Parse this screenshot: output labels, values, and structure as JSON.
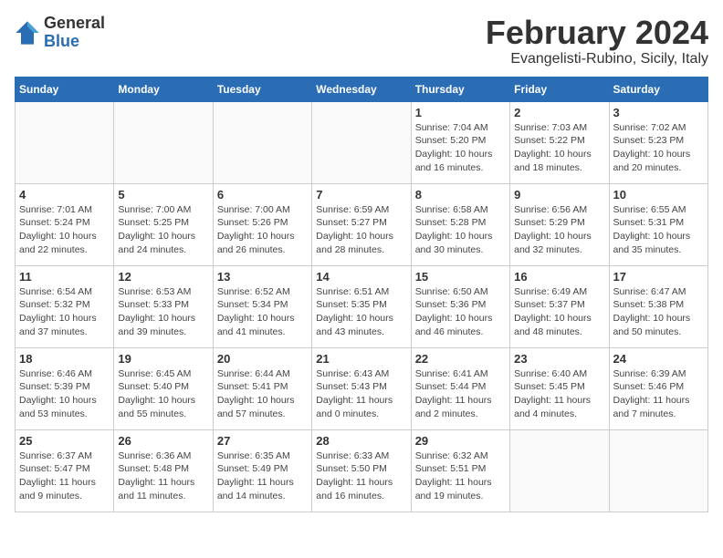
{
  "header": {
    "logo_general": "General",
    "logo_blue": "Blue",
    "title": "February 2024",
    "subtitle": "Evangelisti-Rubino, Sicily, Italy"
  },
  "weekdays": [
    "Sunday",
    "Monday",
    "Tuesday",
    "Wednesday",
    "Thursday",
    "Friday",
    "Saturday"
  ],
  "weeks": [
    [
      {
        "day": "",
        "info": ""
      },
      {
        "day": "",
        "info": ""
      },
      {
        "day": "",
        "info": ""
      },
      {
        "day": "",
        "info": ""
      },
      {
        "day": "1",
        "info": "Sunrise: 7:04 AM\nSunset: 5:20 PM\nDaylight: 10 hours\nand 16 minutes."
      },
      {
        "day": "2",
        "info": "Sunrise: 7:03 AM\nSunset: 5:22 PM\nDaylight: 10 hours\nand 18 minutes."
      },
      {
        "day": "3",
        "info": "Sunrise: 7:02 AM\nSunset: 5:23 PM\nDaylight: 10 hours\nand 20 minutes."
      }
    ],
    [
      {
        "day": "4",
        "info": "Sunrise: 7:01 AM\nSunset: 5:24 PM\nDaylight: 10 hours\nand 22 minutes."
      },
      {
        "day": "5",
        "info": "Sunrise: 7:00 AM\nSunset: 5:25 PM\nDaylight: 10 hours\nand 24 minutes."
      },
      {
        "day": "6",
        "info": "Sunrise: 7:00 AM\nSunset: 5:26 PM\nDaylight: 10 hours\nand 26 minutes."
      },
      {
        "day": "7",
        "info": "Sunrise: 6:59 AM\nSunset: 5:27 PM\nDaylight: 10 hours\nand 28 minutes."
      },
      {
        "day": "8",
        "info": "Sunrise: 6:58 AM\nSunset: 5:28 PM\nDaylight: 10 hours\nand 30 minutes."
      },
      {
        "day": "9",
        "info": "Sunrise: 6:56 AM\nSunset: 5:29 PM\nDaylight: 10 hours\nand 32 minutes."
      },
      {
        "day": "10",
        "info": "Sunrise: 6:55 AM\nSunset: 5:31 PM\nDaylight: 10 hours\nand 35 minutes."
      }
    ],
    [
      {
        "day": "11",
        "info": "Sunrise: 6:54 AM\nSunset: 5:32 PM\nDaylight: 10 hours\nand 37 minutes."
      },
      {
        "day": "12",
        "info": "Sunrise: 6:53 AM\nSunset: 5:33 PM\nDaylight: 10 hours\nand 39 minutes."
      },
      {
        "day": "13",
        "info": "Sunrise: 6:52 AM\nSunset: 5:34 PM\nDaylight: 10 hours\nand 41 minutes."
      },
      {
        "day": "14",
        "info": "Sunrise: 6:51 AM\nSunset: 5:35 PM\nDaylight: 10 hours\nand 43 minutes."
      },
      {
        "day": "15",
        "info": "Sunrise: 6:50 AM\nSunset: 5:36 PM\nDaylight: 10 hours\nand 46 minutes."
      },
      {
        "day": "16",
        "info": "Sunrise: 6:49 AM\nSunset: 5:37 PM\nDaylight: 10 hours\nand 48 minutes."
      },
      {
        "day": "17",
        "info": "Sunrise: 6:47 AM\nSunset: 5:38 PM\nDaylight: 10 hours\nand 50 minutes."
      }
    ],
    [
      {
        "day": "18",
        "info": "Sunrise: 6:46 AM\nSunset: 5:39 PM\nDaylight: 10 hours\nand 53 minutes."
      },
      {
        "day": "19",
        "info": "Sunrise: 6:45 AM\nSunset: 5:40 PM\nDaylight: 10 hours\nand 55 minutes."
      },
      {
        "day": "20",
        "info": "Sunrise: 6:44 AM\nSunset: 5:41 PM\nDaylight: 10 hours\nand 57 minutes."
      },
      {
        "day": "21",
        "info": "Sunrise: 6:43 AM\nSunset: 5:43 PM\nDaylight: 11 hours\nand 0 minutes."
      },
      {
        "day": "22",
        "info": "Sunrise: 6:41 AM\nSunset: 5:44 PM\nDaylight: 11 hours\nand 2 minutes."
      },
      {
        "day": "23",
        "info": "Sunrise: 6:40 AM\nSunset: 5:45 PM\nDaylight: 11 hours\nand 4 minutes."
      },
      {
        "day": "24",
        "info": "Sunrise: 6:39 AM\nSunset: 5:46 PM\nDaylight: 11 hours\nand 7 minutes."
      }
    ],
    [
      {
        "day": "25",
        "info": "Sunrise: 6:37 AM\nSunset: 5:47 PM\nDaylight: 11 hours\nand 9 minutes."
      },
      {
        "day": "26",
        "info": "Sunrise: 6:36 AM\nSunset: 5:48 PM\nDaylight: 11 hours\nand 11 minutes."
      },
      {
        "day": "27",
        "info": "Sunrise: 6:35 AM\nSunset: 5:49 PM\nDaylight: 11 hours\nand 14 minutes."
      },
      {
        "day": "28",
        "info": "Sunrise: 6:33 AM\nSunset: 5:50 PM\nDaylight: 11 hours\nand 16 minutes."
      },
      {
        "day": "29",
        "info": "Sunrise: 6:32 AM\nSunset: 5:51 PM\nDaylight: 11 hours\nand 19 minutes."
      },
      {
        "day": "",
        "info": ""
      },
      {
        "day": "",
        "info": ""
      }
    ]
  ]
}
